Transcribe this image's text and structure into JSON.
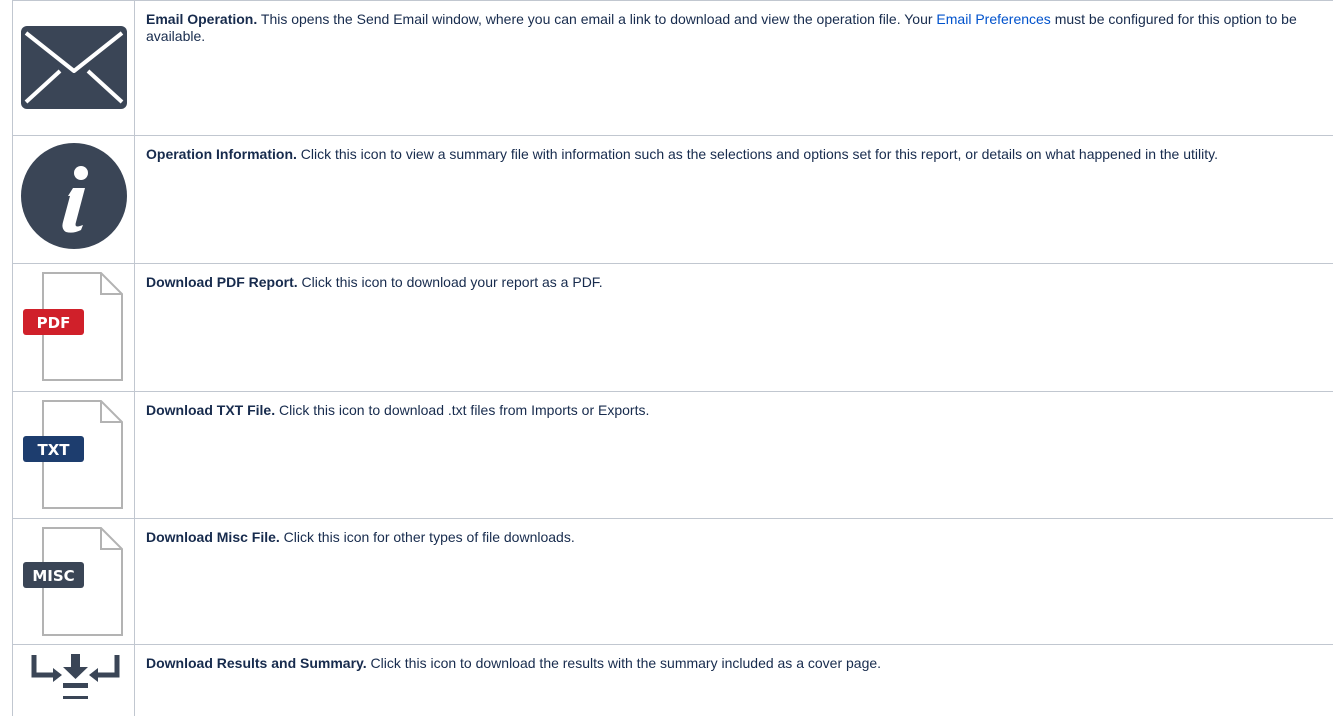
{
  "rows": [
    {
      "id": "email",
      "icon": "email-envelope-icon",
      "title": "Email Operation.",
      "text_before": " This opens the Send Email window, where you can email a link to download and view the operation file. Your ",
      "link": "Email Preferences",
      "text_after": " must be configured for this option to be available."
    },
    {
      "id": "info",
      "icon": "info-icon",
      "title": "Operation Information.",
      "text": " Click this icon to view a summary file with information such as the selections and options set for this report, or details on what happened in the utility."
    },
    {
      "id": "pdf",
      "icon": "pdf-file-icon",
      "badge": "PDF",
      "title": "Download PDF Report.",
      "text": " Click this icon to download your report as a PDF."
    },
    {
      "id": "txt",
      "icon": "txt-file-icon",
      "badge": "TXT",
      "title": "Download TXT File.",
      "text": " Click this icon to download .txt files from Imports or Exports."
    },
    {
      "id": "misc",
      "icon": "misc-file-icon",
      "badge": "MISC",
      "title": "Download Misc File.",
      "text": " Click this icon for other types of file downloads."
    },
    {
      "id": "results",
      "icon": "download-results-icon",
      "title": "Download Results and Summary.",
      "text": " Click this icon to download the results with the summary included as a cover page."
    }
  ],
  "colors": {
    "link": "#0052cc",
    "border": "#c1c7d0",
    "icon_dark": "#3a4556",
    "pdf_badge": "#d0202a",
    "txt_badge": "#1d3d6e",
    "misc_badge": "#3a4556"
  }
}
